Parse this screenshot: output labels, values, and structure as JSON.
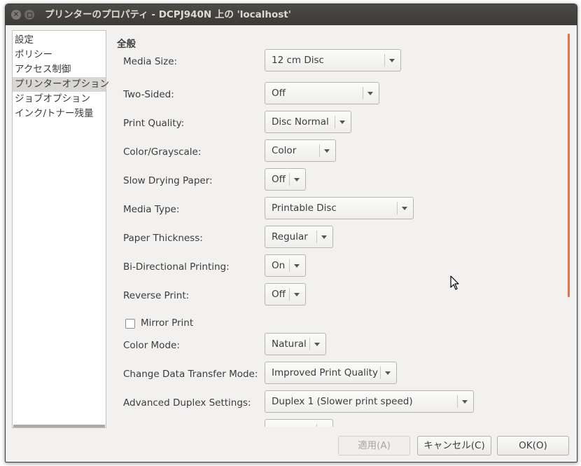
{
  "window": {
    "title": "プリンターのプロパティ - DCPJ940N 上の 'localhost'",
    "close_glyph": "×"
  },
  "sidebar": {
    "items": [
      {
        "label": "設定"
      },
      {
        "label": "ポリシー"
      },
      {
        "label": "アクセス制御"
      },
      {
        "label": "プリンターオプション",
        "selected": true
      },
      {
        "label": "ジョブオプション"
      },
      {
        "label": "インク/トナー残量"
      }
    ]
  },
  "content": {
    "section_title": "全般",
    "options": [
      {
        "label": "Media Size:",
        "value": "12 cm Disc"
      },
      {
        "label": "Two-Sided:",
        "value": "Off"
      },
      {
        "label": "Print Quality:",
        "value": "Disc Normal"
      },
      {
        "label": "Color/Grayscale:",
        "value": "Color"
      },
      {
        "label": "Slow Drying Paper:",
        "value": "Off"
      },
      {
        "label": "Media Type:",
        "value": "Printable Disc"
      },
      {
        "label": "Paper Thickness:",
        "value": "Regular"
      },
      {
        "label": "Bi-Directional Printing:",
        "value": "On"
      },
      {
        "label": "Reverse Print:",
        "value": "Off"
      },
      {
        "label": "Color Mode:",
        "value": "Natural"
      },
      {
        "label": "Change Data Transfer Mode:",
        "value": "Improved Print Quality"
      },
      {
        "label": "Advanced Duplex Settings:",
        "value": "Duplex 1 (Slower print speed)"
      }
    ],
    "mirror_print": {
      "label": "Mirror Print",
      "checked": false
    }
  },
  "buttons": {
    "apply": "適用(A)",
    "cancel": "キャンセル(C)",
    "ok": "OK(O)"
  },
  "colors": {
    "titlebar": "#3b3a36",
    "scroll_indicator": "#e8704a",
    "selection": "#d8d7d4"
  }
}
